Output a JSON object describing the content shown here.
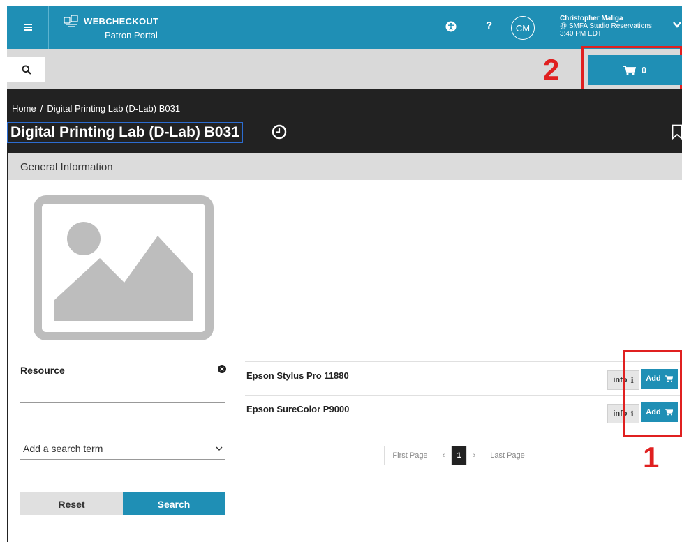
{
  "header": {
    "brand_name": "WEBCHECKOUT",
    "brand_subtitle": "Patron Portal",
    "avatar_initials": "CM",
    "user_name": "Christopher Maliga",
    "user_context": "@ SMFA Studio Reservations",
    "user_time": "3:40 PM EDT",
    "help_label": "?"
  },
  "cart": {
    "count": "0"
  },
  "annotations": {
    "cart_marker": "2",
    "add_marker": "1",
    "highlight_color": "#e02020"
  },
  "breadcrumb": {
    "home": "Home",
    "separator": "/",
    "current": "Digital Printing Lab (D-Lab) B031"
  },
  "page": {
    "title": "Digital Printing Lab (D-Lab) B031"
  },
  "panel": {
    "heading": "General Information"
  },
  "filter": {
    "resource_label": "Resource",
    "resource_value": "",
    "search_term_placeholder": "Add a search term",
    "reset_label": "Reset",
    "search_label": "Search"
  },
  "results": [
    {
      "name": "Epson Stylus Pro 11880",
      "info_label": "info",
      "add_label": "Add"
    },
    {
      "name": "Epson SureColor P9000",
      "info_label": "info",
      "add_label": "Add"
    }
  ],
  "pagination": {
    "first": "First Page",
    "prev": "‹",
    "current": "1",
    "next": "›",
    "last": "Last Page"
  },
  "colors": {
    "brand": "#1f8fb5",
    "dark": "#222222",
    "subbar": "#d9d9d9"
  },
  "icons": {
    "menu": "hamburger-icon",
    "logo": "webcheckout-logo-icon",
    "accessibility": "accessibility-icon",
    "help": "help-icon",
    "chevron": "chevron-down-icon",
    "search": "search-icon",
    "cart": "cart-icon",
    "clock": "clock-icon",
    "bookmark": "bookmark-icon",
    "image_placeholder": "image-placeholder-icon",
    "clear": "clear-icon"
  }
}
